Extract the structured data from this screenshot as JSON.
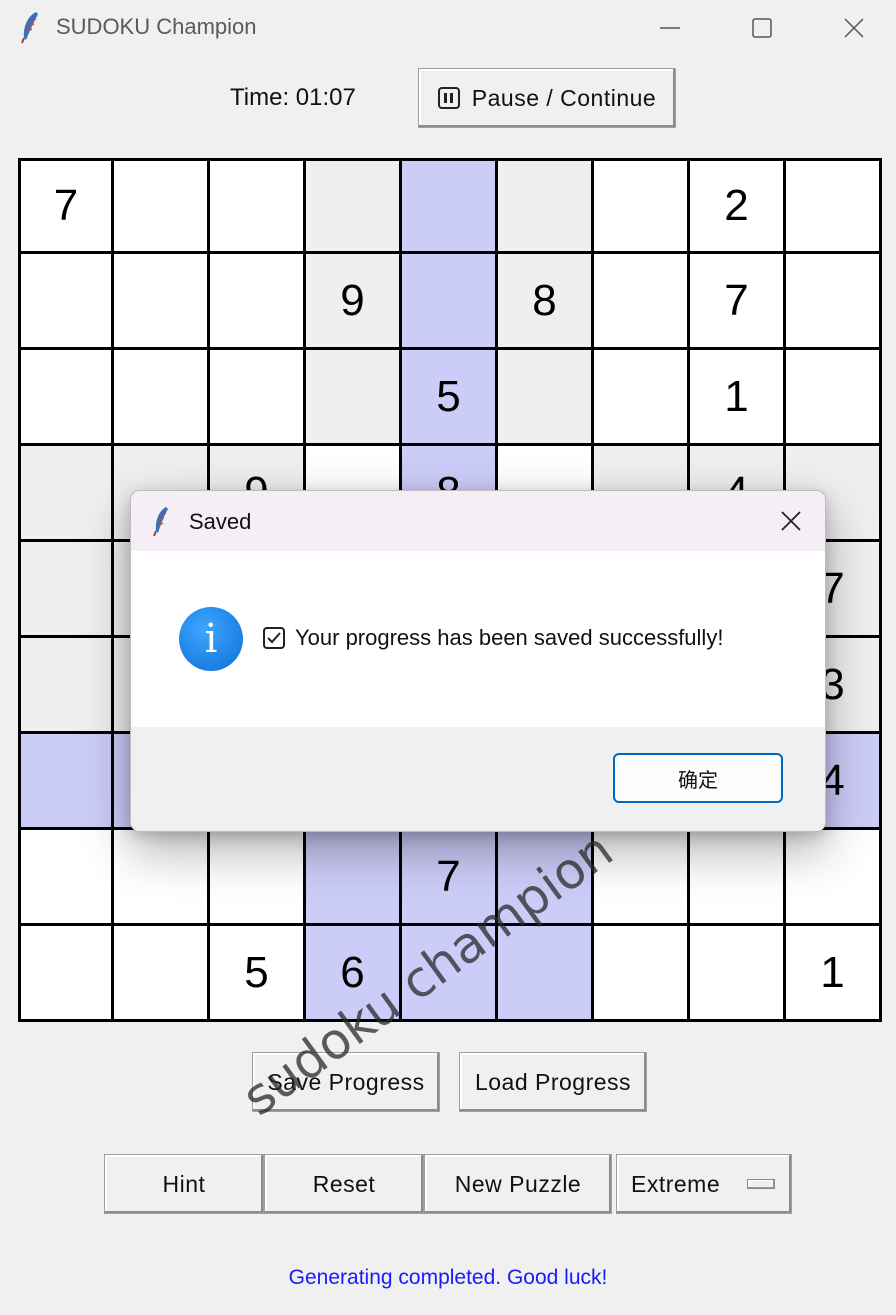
{
  "window": {
    "title": "SUDOKU Champion"
  },
  "timer": {
    "text": "Time: 01:07"
  },
  "pause_button": {
    "label": "Pause / Continue"
  },
  "grid": [
    [
      "7",
      "",
      "",
      "",
      "",
      "",
      "",
      "2",
      ""
    ],
    [
      "",
      "",
      "",
      "9",
      "",
      "8",
      "",
      "7",
      ""
    ],
    [
      "",
      "",
      "",
      "",
      "5",
      "",
      "",
      "1",
      ""
    ],
    [
      "",
      "",
      "9",
      "",
      "8",
      "",
      "",
      "4",
      ""
    ],
    [
      "",
      "",
      "",
      "",
      "",
      "",
      "",
      "",
      "7"
    ],
    [
      "",
      "",
      "",
      "",
      "",
      "",
      "",
      "",
      "3"
    ],
    [
      "",
      "",
      "",
      "",
      "",
      "",
      "",
      "",
      "4"
    ],
    [
      "",
      "",
      "",
      "",
      "7",
      "",
      "",
      "",
      ""
    ],
    [
      "",
      "",
      "5",
      "6",
      "",
      "",
      "",
      "",
      "1"
    ]
  ],
  "grid_shading": [
    "wwwghgwww",
    "wwwghgwww",
    "wwwghgwww",
    "gggwhwggg",
    "gggwhwggg",
    "gggwhwggg",
    "hhhhhhhhh",
    "wwwhhhwww",
    "wwwhhhwww"
  ],
  "buttons": {
    "save": "Save Progress",
    "load": "Load Progress",
    "hint": "Hint",
    "reset": "Reset",
    "new_puzzle": "New Puzzle",
    "difficulty": "Extreme"
  },
  "status": {
    "text": "Generating completed. Good luck!"
  },
  "watermark": {
    "text": "sudoku champion"
  },
  "dialog": {
    "title": "Saved",
    "message": "Your progress has been saved successfully!",
    "ok_label": "确定",
    "icon": "info-icon"
  },
  "colors": {
    "highlight": "#ccccf9",
    "box_gray": "#efefef",
    "status_text": "#1a1aff",
    "dialog_titlebar": "#f5eef6",
    "ok_border": "#0067c0"
  }
}
